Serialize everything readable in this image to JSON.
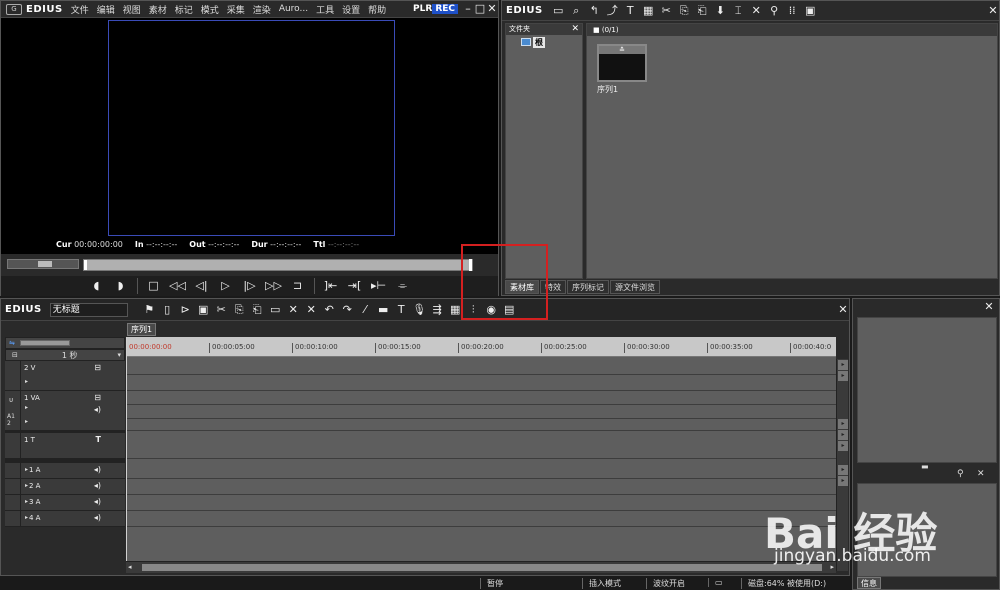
{
  "player": {
    "brand": "EDIUS",
    "logo_glyph": "G",
    "menu": [
      "文件",
      "编辑",
      "视图",
      "素材",
      "标记",
      "模式",
      "采集",
      "渲染",
      "Auro...",
      "工具",
      "设置",
      "帮助"
    ],
    "plr": "PLR",
    "rec": "REC",
    "timecodes": [
      {
        "label": "Cur",
        "value": "00:00:00:00",
        "dim": false
      },
      {
        "label": "In",
        "value": "--:--:--:--",
        "dim": false
      },
      {
        "label": "Out",
        "value": "--:--:--:--",
        "dim": false
      },
      {
        "label": "Dur",
        "value": "--:--:--:--",
        "dim": false
      },
      {
        "label": "Ttl",
        "value": "--:--:--:--",
        "dim": true
      }
    ]
  },
  "bin": {
    "brand": "EDIUS",
    "folder_panel_title": "文件夹",
    "root_label": "根",
    "clip_header": "■ (0/1)",
    "clip_name": "序列1",
    "clip_thumb_label": "≛",
    "tabs": [
      "素材库",
      "特效",
      "序列标记",
      "源文件浏览"
    ]
  },
  "timeline": {
    "brand": "EDIUS",
    "project_name": "无标题",
    "sequence_tab": "序列1",
    "scale_label": "1 秒",
    "ruler_ticks": [
      "00:00:00:00",
      "00:00:05:00",
      "00:00:10:00",
      "00:00:15:00",
      "00:00:20:00",
      "00:00:25:00",
      "00:00:30:00",
      "00:00:35:00",
      "00:00:40:0"
    ],
    "tracks": [
      {
        "name": "2 V"
      },
      {
        "name": "1 VA"
      },
      {
        "name": "1 T"
      },
      {
        "name": "1 A"
      },
      {
        "name": "2 A"
      },
      {
        "name": "3 A"
      },
      {
        "name": "4 A"
      }
    ]
  },
  "info": {
    "tab": "信息"
  },
  "status": {
    "pause": "暂停",
    "insert_mode": "插入模式",
    "ripple": "波纹开启",
    "disk": "磁盘:64% 被使用(D:)"
  },
  "watermark": {
    "line1": "Bai 经验",
    "line2": "jingyan.baidu.com"
  }
}
